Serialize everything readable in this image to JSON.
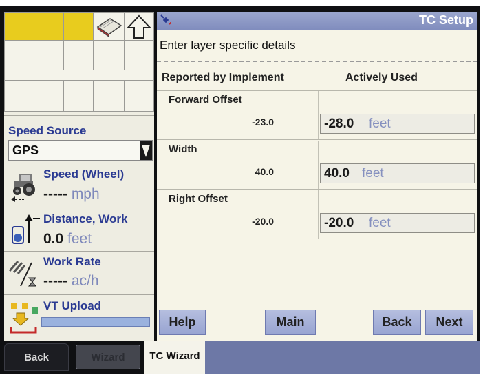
{
  "header": {
    "title": "TC Setup",
    "subtitle": "Enter layer specific details"
  },
  "columns": {
    "reported": "Reported by Implement",
    "active": "Actively Used"
  },
  "rows": [
    {
      "name": "Forward Offset",
      "reported": "-23.0",
      "active_value": "-28.0",
      "unit": "feet"
    },
    {
      "name": "Width",
      "reported": "40.0",
      "active_value": "40.0",
      "unit": "feet"
    },
    {
      "name": "Right Offset",
      "reported": "-20.0",
      "active_value": "-20.0",
      "unit": "feet"
    }
  ],
  "buttons": {
    "help": "Help",
    "main": "Main",
    "back": "Back",
    "next": "Next"
  },
  "sidebar": {
    "speed_source_label": "Speed Source",
    "speed_source_value": "GPS",
    "speed_label": "Speed (Wheel)",
    "speed_value": "-----",
    "speed_unit": "mph",
    "distance_label": "Distance, Work",
    "distance_value": "0.0",
    "distance_unit": "feet",
    "work_rate_label": "Work Rate",
    "work_rate_value": "-----",
    "work_rate_unit": "ac/h",
    "vt_upload_label": "VT Upload"
  },
  "tabs": [
    {
      "label": "Back"
    },
    {
      "label": "Wizard"
    },
    {
      "label": "TC Wizard"
    }
  ],
  "colors": {
    "accent": "#9aa6cd",
    "label": "#2a3a92",
    "shortcut_yellow": "#e8cc1e"
  },
  "icons": [
    "book-icon",
    "up-arrow-icon",
    "satellite-icon",
    "tractor-icon",
    "distance-icon",
    "work-rate-icon",
    "upload-icon",
    "dropdown-arrow-icon"
  ]
}
